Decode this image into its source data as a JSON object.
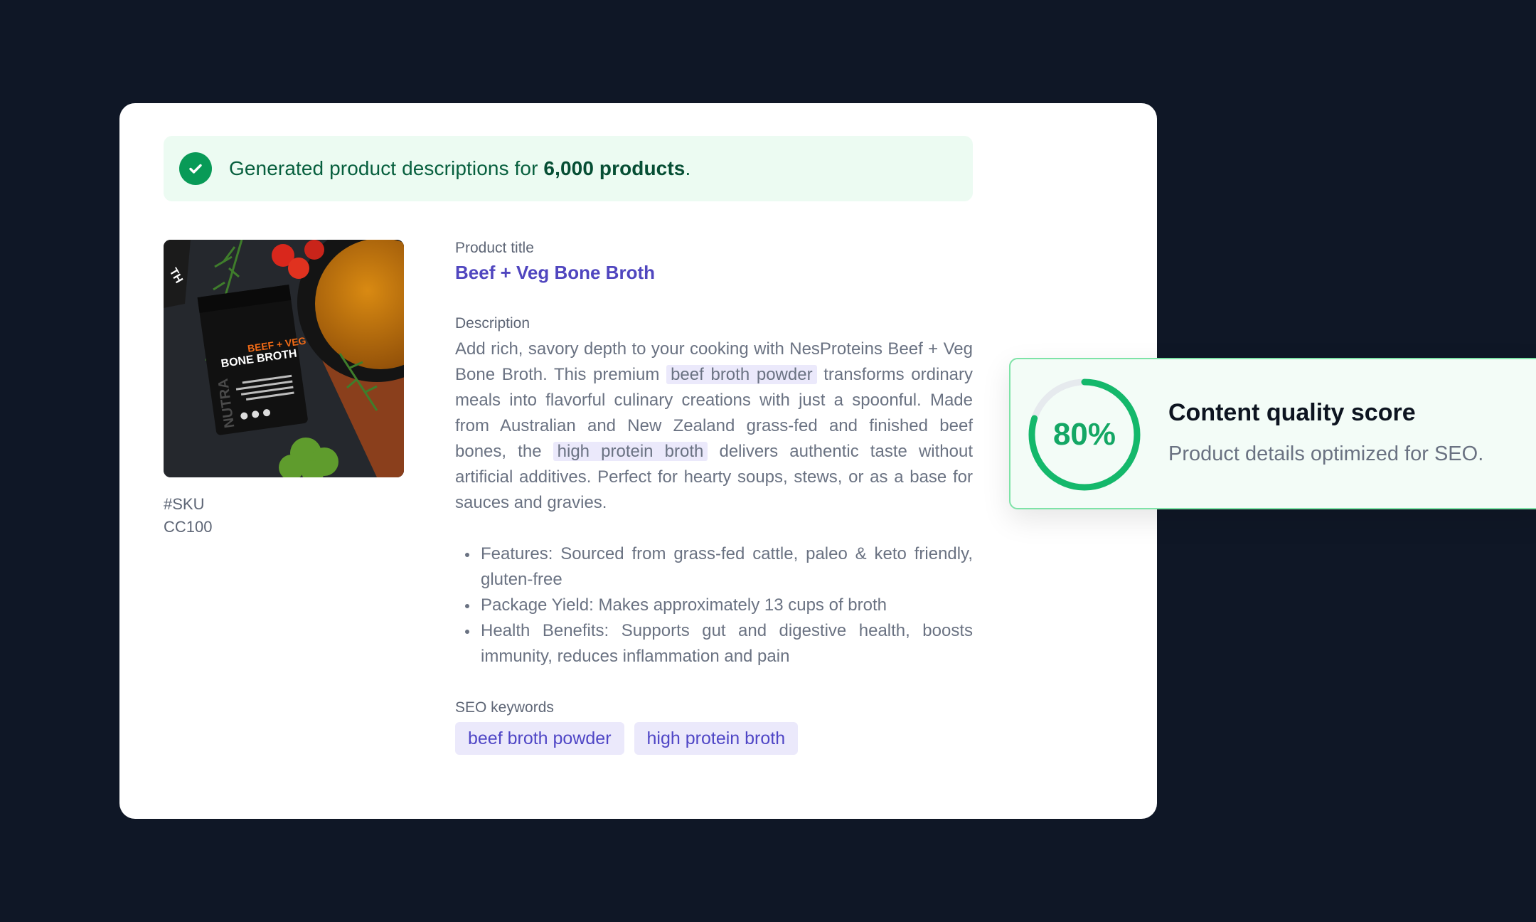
{
  "banner": {
    "text_prefix": "Generated product descriptions for ",
    "text_bold": "6,000 products",
    "text_suffix": ".",
    "icon": "check-circle-icon",
    "color": "#089a57"
  },
  "product": {
    "image_alt": "Beef + Veg Bone Broth package",
    "image_text": {
      "brand": "NUTRA",
      "variant": "BEEF + VEG",
      "name": "BONE BROTH"
    },
    "sku_label": "#SKU",
    "sku_value": "CC100",
    "title_label": "Product title",
    "title": "Beef + Veg Bone Broth",
    "description_label": "Description",
    "description": {
      "p1": "Add rich, savory depth to your cooking with NesProteins Beef + Veg Bone Broth. This premium ",
      "k1": "beef broth powder",
      "p2": " transforms ordinary meals into flavorful culinary creations with just a spoonful. Made from Australian and New Zealand grass-fed and finished beef bones, the ",
      "k2": "high protein broth",
      "p3": " delivers authentic taste without artificial additives. Perfect for hearty soups, stews, or as a base for sauces and gravies."
    },
    "bullets": [
      "Features: Sourced from grass-fed cattle, paleo & keto friendly, gluten-free",
      "Package Yield: Makes approximately 13 cups of broth",
      "Health Benefits: Supports gut and digestive health, boosts immunity, reduces inflammation and pain"
    ],
    "seo_label": "SEO keywords",
    "seo_keywords": [
      "beef broth powder",
      "high protein broth"
    ]
  },
  "score": {
    "value_label": "80%",
    "value": 0.8,
    "title": "Content quality score",
    "subtitle": "Product details optimized for SEO.",
    "color": "#14b86b"
  },
  "colors": {
    "background": "#0f1726",
    "accent": "#5046bf",
    "keyword_bg": "#ebe9fb"
  }
}
